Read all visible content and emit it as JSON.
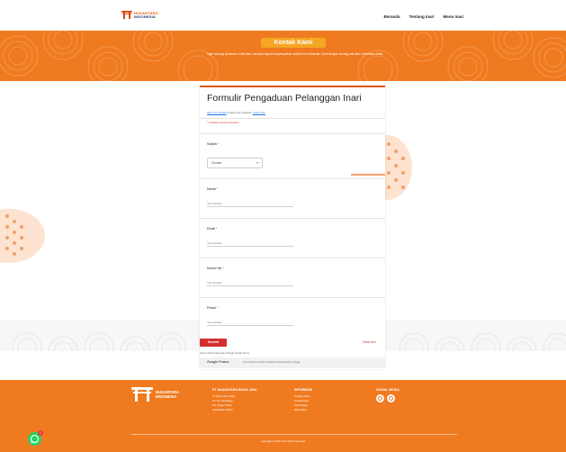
{
  "header": {
    "logo_text_top": "NUSANTARA",
    "logo_text_bottom": "INDONESIA",
    "nav": [
      {
        "label": "Beranda"
      },
      {
        "label": "Tentang Inari"
      },
      {
        "label": "Menu Inari"
      }
    ]
  },
  "hero": {
    "title": "Kontak Kami",
    "subtitle": "Ingin hubungi peraturan, kritik atau masukan dapat menyampaikan melalui form dibawah. Kami dengan senang hati akan membantu Anda."
  },
  "form": {
    "title": "Formulir Pengaduan Pelanggan Inari",
    "signin_prefix": "Sign in to Google",
    "signin_suffix": "to save your progress.",
    "signin_link": "Learn more",
    "required_note": "* Indicates required question",
    "questions": [
      {
        "label": "Subjek",
        "type": "select",
        "value": "Choose"
      },
      {
        "label": "Nama",
        "type": "text",
        "placeholder": "Your answer"
      },
      {
        "label": "Email",
        "type": "text",
        "placeholder": "Your answer"
      },
      {
        "label": "Nomor Hp",
        "type": "text",
        "placeholder": "Your answer"
      },
      {
        "label": "Pesan",
        "type": "text",
        "placeholder": "Your answer"
      }
    ],
    "submit_label": "Submit",
    "clear_label": "Clear form",
    "never_note": "Never submit passwords through Google Forms.",
    "gforms_logo": "Google Forms",
    "gforms_text": "This content is neither created nor endorsed by Google."
  },
  "footer": {
    "logo_top": "NUSANTARA",
    "logo_bottom": "INDONESIA",
    "company": {
      "heading": "PT NASANTARA BOGA JAYA",
      "lines": [
        "Jl. Raya Suka Indah",
        "No 10, Kota Bogor",
        "Kec. Bogor Utara",
        "Jawa Barat 16154"
      ]
    },
    "info": {
      "heading": "INFORMASI",
      "links": [
        "Tentang Kami",
        "Kontak Kami",
        "Franchising",
        "Blog Artikel"
      ]
    },
    "social": {
      "heading": "SOSIAL MEDIA"
    },
    "copyright": "Copyright © 2023. Inari Sushi Indonesia"
  },
  "whatsapp": {
    "badge": "1"
  },
  "colors": {
    "brand_orange": "#f07a1f",
    "submit_red": "#d32f2f",
    "whatsapp_green": "#25d366"
  }
}
